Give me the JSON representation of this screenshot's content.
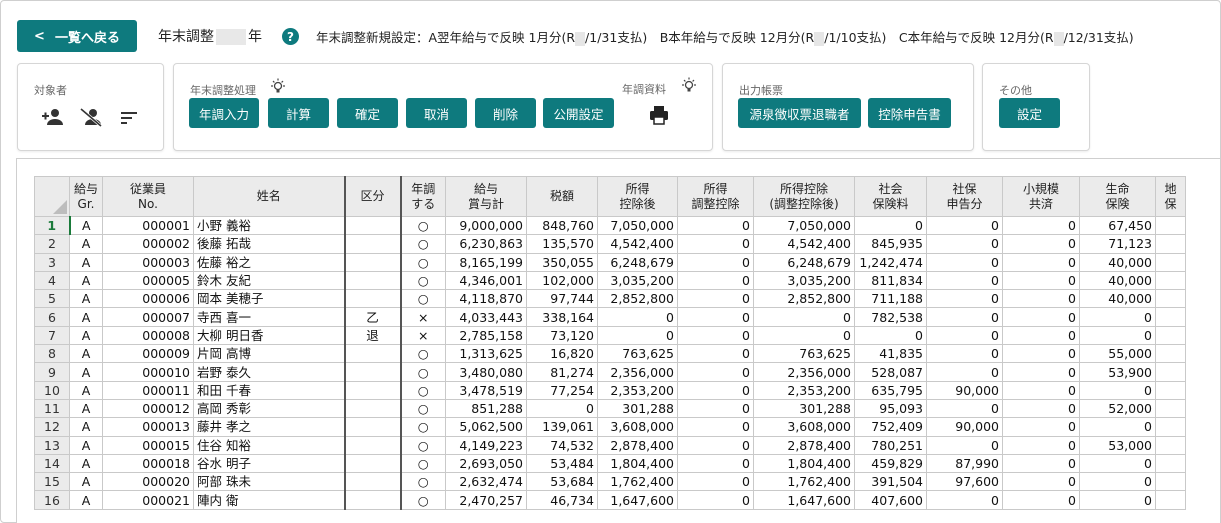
{
  "header": {
    "back_label": "一覧へ戻る",
    "title_prefix": "年末調整",
    "title_suffix": "年",
    "settings_note": {
      "p1": "年末調整新規設定：A翌年給与で反映 1月分(R",
      "p2": "/1/31支払)　B本年給与で反映 12月分(R",
      "p3": "/1/10支払)　C本年給与で反映 12月分(R",
      "p4": "/12/31支払)"
    }
  },
  "panels": {
    "target": {
      "label": "対象者"
    },
    "processing": {
      "label": "年末調整処理",
      "buttons": [
        "年調入力",
        "計算",
        "確定",
        "取消",
        "削除",
        "公開設定"
      ],
      "materials_label": "年調資料"
    },
    "output": {
      "label": "出力帳票",
      "buttons": [
        "源泉徴収票退職者",
        "控除申告書"
      ]
    },
    "other": {
      "label": "その他",
      "buttons": [
        "設定"
      ]
    }
  },
  "table": {
    "headers": [
      "給与\nGr.",
      "従業員\nNo.",
      "姓名",
      "区分",
      "年調\nする",
      "給与\n賞与計",
      "税額",
      "所得\n控除後",
      "所得\n調整控除",
      "所得控除\n(調整控除後)",
      "社会\n保険料",
      "社保\n申告分",
      "小規模\n共済",
      "生命\n保険",
      "地\n保"
    ],
    "rows": [
      {
        "n": "1",
        "gr": "A",
        "no": "000001",
        "name": "小野 義裕",
        "kubun": "",
        "nencho": "○",
        "pay": "9,000,000",
        "tax": "848,760",
        "after": "7,050,000",
        "adj": "0",
        "ded": "7,050,000",
        "soc": "0",
        "shaho": "0",
        "small": "0",
        "life": "67,450"
      },
      {
        "n": "2",
        "gr": "A",
        "no": "000002",
        "name": "後藤 拓哉",
        "kubun": "",
        "nencho": "○",
        "pay": "6,230,863",
        "tax": "135,570",
        "after": "4,542,400",
        "adj": "0",
        "ded": "4,542,400",
        "soc": "845,935",
        "shaho": "0",
        "small": "0",
        "life": "71,123"
      },
      {
        "n": "3",
        "gr": "A",
        "no": "000003",
        "name": "佐藤 裕之",
        "kubun": "",
        "nencho": "○",
        "pay": "8,165,199",
        "tax": "350,055",
        "after": "6,248,679",
        "adj": "0",
        "ded": "6,248,679",
        "soc": "1,242,474",
        "shaho": "0",
        "small": "0",
        "life": "40,000"
      },
      {
        "n": "4",
        "gr": "A",
        "no": "000005",
        "name": "鈴木 友紀",
        "kubun": "",
        "nencho": "○",
        "pay": "4,346,001",
        "tax": "102,000",
        "after": "3,035,200",
        "adj": "0",
        "ded": "3,035,200",
        "soc": "811,834",
        "shaho": "0",
        "small": "0",
        "life": "40,000"
      },
      {
        "n": "5",
        "gr": "A",
        "no": "000006",
        "name": "岡本 美穂子",
        "kubun": "",
        "nencho": "○",
        "pay": "4,118,870",
        "tax": "97,744",
        "after": "2,852,800",
        "adj": "0",
        "ded": "2,852,800",
        "soc": "711,188",
        "shaho": "0",
        "small": "0",
        "life": "40,000"
      },
      {
        "n": "6",
        "gr": "A",
        "no": "000007",
        "name": "寺西 喜一",
        "kubun": "乙",
        "nencho": "×",
        "pay": "4,033,443",
        "tax": "338,164",
        "after": "0",
        "adj": "0",
        "ded": "0",
        "soc": "782,538",
        "shaho": "0",
        "small": "0",
        "life": "0"
      },
      {
        "n": "7",
        "gr": "A",
        "no": "000008",
        "name": "大柳 明日香",
        "kubun": "退",
        "nencho": "×",
        "pay": "2,785,158",
        "tax": "73,120",
        "after": "0",
        "adj": "0",
        "ded": "0",
        "soc": "0",
        "shaho": "0",
        "small": "0",
        "life": "0"
      },
      {
        "n": "8",
        "gr": "A",
        "no": "000009",
        "name": "片岡 高博",
        "kubun": "",
        "nencho": "○",
        "pay": "1,313,625",
        "tax": "16,820",
        "after": "763,625",
        "adj": "0",
        "ded": "763,625",
        "soc": "41,835",
        "shaho": "0",
        "small": "0",
        "life": "55,000"
      },
      {
        "n": "9",
        "gr": "A",
        "no": "000010",
        "name": "岩野 泰久",
        "kubun": "",
        "nencho": "○",
        "pay": "3,480,080",
        "tax": "81,274",
        "after": "2,356,000",
        "adj": "0",
        "ded": "2,356,000",
        "soc": "528,087",
        "shaho": "0",
        "small": "0",
        "life": "53,900"
      },
      {
        "n": "10",
        "gr": "A",
        "no": "000011",
        "name": "和田 千春",
        "kubun": "",
        "nencho": "○",
        "pay": "3,478,519",
        "tax": "77,254",
        "after": "2,353,200",
        "adj": "0",
        "ded": "2,353,200",
        "soc": "635,795",
        "shaho": "90,000",
        "small": "0",
        "life": "0"
      },
      {
        "n": "11",
        "gr": "A",
        "no": "000012",
        "name": "高岡 秀彰",
        "kubun": "",
        "nencho": "○",
        "pay": "851,288",
        "tax": "0",
        "after": "301,288",
        "adj": "0",
        "ded": "301,288",
        "soc": "95,093",
        "shaho": "0",
        "small": "0",
        "life": "52,000"
      },
      {
        "n": "12",
        "gr": "A",
        "no": "000013",
        "name": "藤井 孝之",
        "kubun": "",
        "nencho": "○",
        "pay": "5,062,500",
        "tax": "139,061",
        "after": "3,608,000",
        "adj": "0",
        "ded": "3,608,000",
        "soc": "752,409",
        "shaho": "90,000",
        "small": "0",
        "life": "0"
      },
      {
        "n": "13",
        "gr": "A",
        "no": "000015",
        "name": "住谷 知裕",
        "kubun": "",
        "nencho": "○",
        "pay": "4,149,223",
        "tax": "74,532",
        "after": "2,878,400",
        "adj": "0",
        "ded": "2,878,400",
        "soc": "780,251",
        "shaho": "0",
        "small": "0",
        "life": "53,000"
      },
      {
        "n": "14",
        "gr": "A",
        "no": "000018",
        "name": "谷水 明子",
        "kubun": "",
        "nencho": "○",
        "pay": "2,693,050",
        "tax": "53,484",
        "after": "1,804,400",
        "adj": "0",
        "ded": "1,804,400",
        "soc": "459,829",
        "shaho": "87,990",
        "small": "0",
        "life": "0"
      },
      {
        "n": "15",
        "gr": "A",
        "no": "000020",
        "name": "阿部 珠未",
        "kubun": "",
        "nencho": "○",
        "pay": "2,632,474",
        "tax": "53,684",
        "after": "1,762,400",
        "adj": "0",
        "ded": "1,762,400",
        "soc": "391,504",
        "shaho": "97,600",
        "small": "0",
        "life": "0"
      },
      {
        "n": "16",
        "gr": "A",
        "no": "000021",
        "name": "陣内 衛",
        "kubun": "",
        "nencho": "○",
        "pay": "2,470,257",
        "tax": "46,734",
        "after": "1,647,600",
        "adj": "0",
        "ded": "1,647,600",
        "soc": "407,600",
        "shaho": "0",
        "small": "0",
        "life": "0"
      }
    ]
  },
  "colors": {
    "accent": "#0e7a7e",
    "header_bg": "#ebebeb",
    "active_row": "#1a7a3a"
  }
}
